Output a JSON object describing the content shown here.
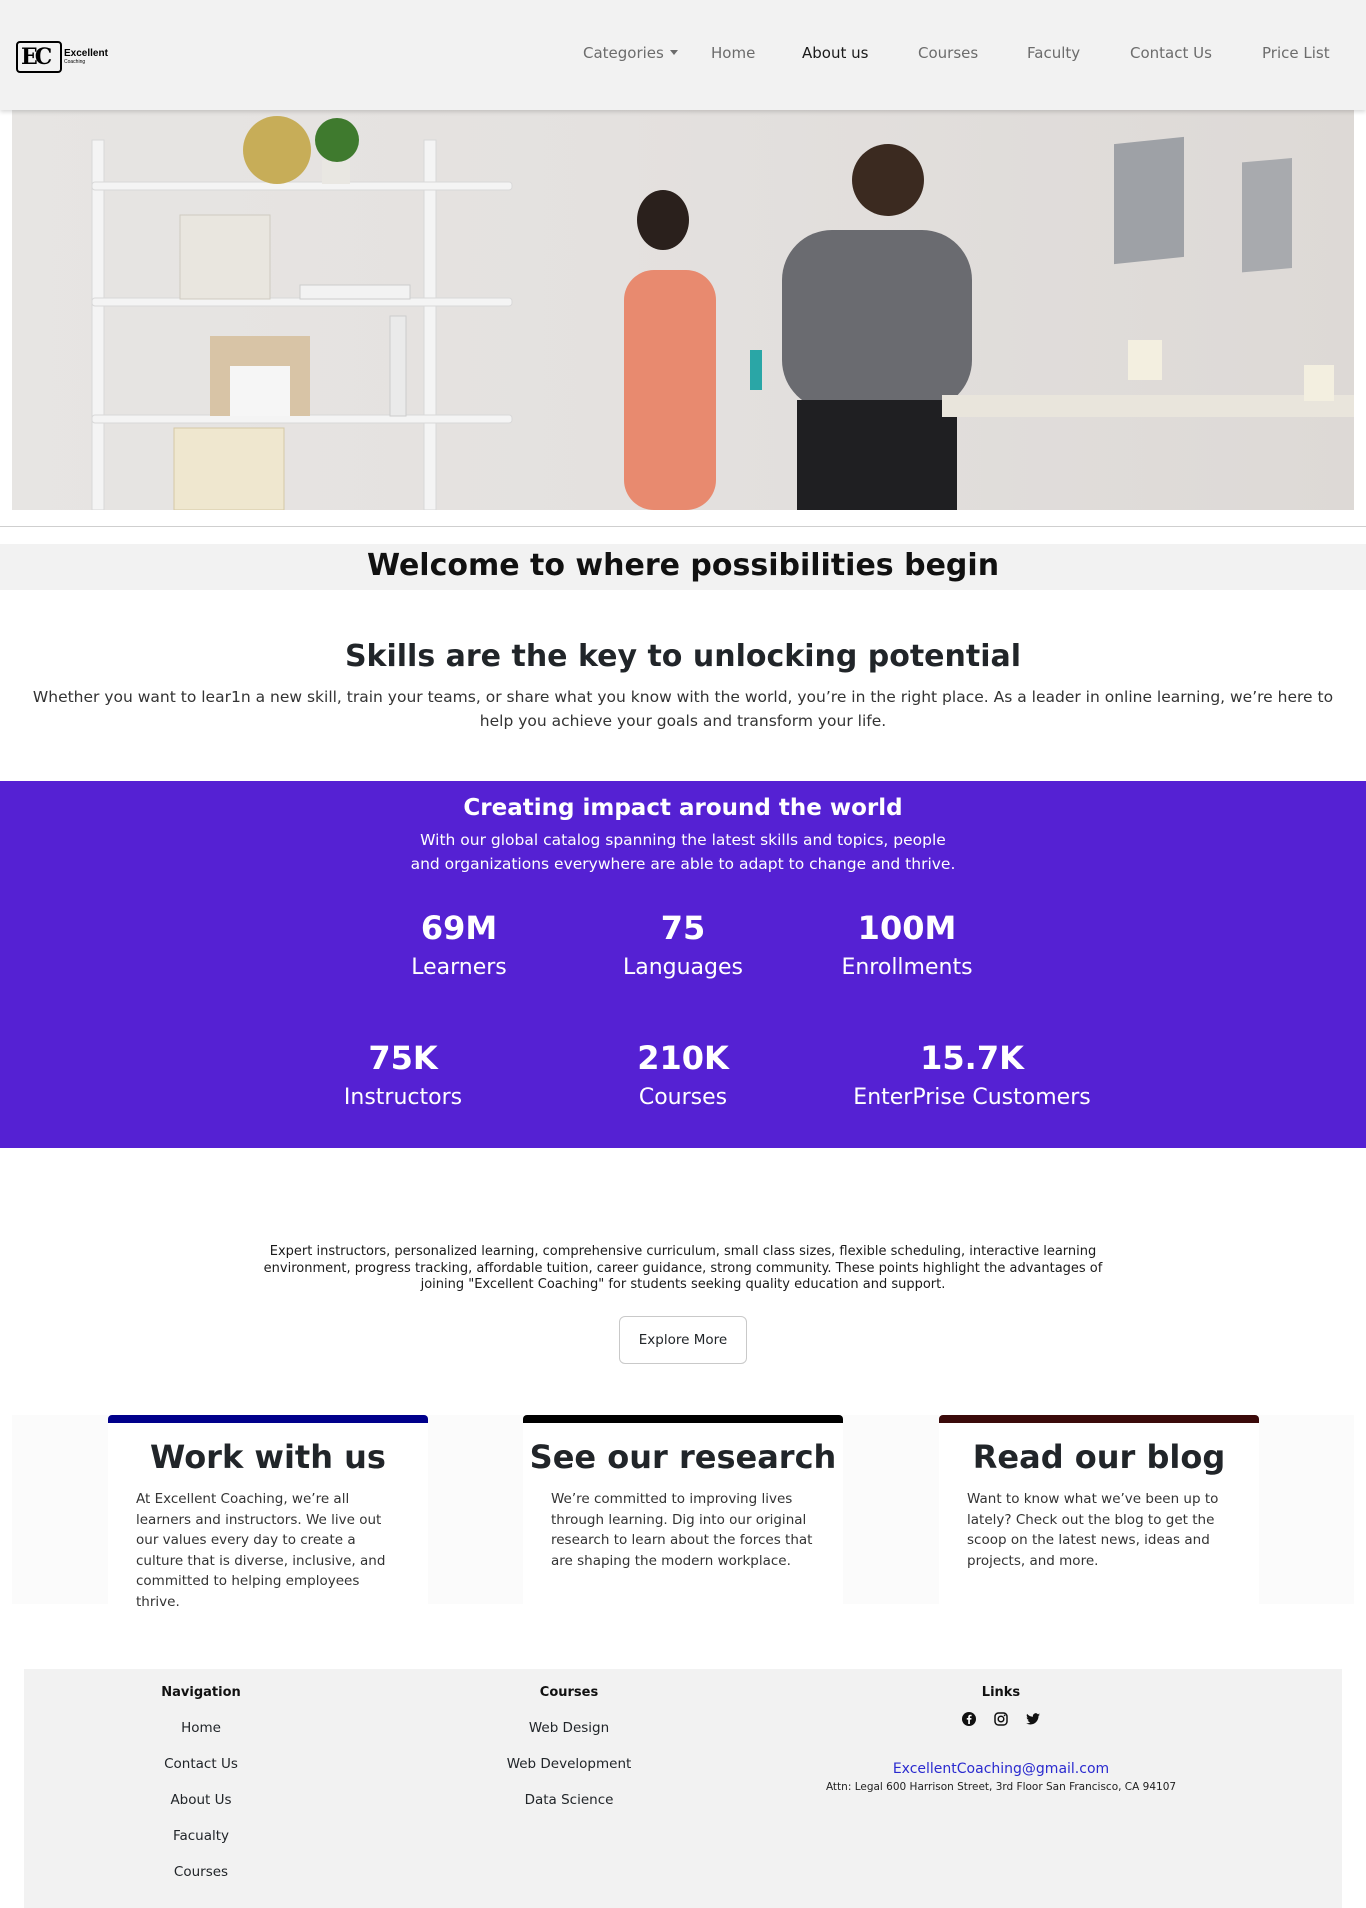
{
  "brand": {
    "logo_mark": "EC",
    "name": "Excellent",
    "tagline": "Coaching"
  },
  "nav": {
    "categories": "Categories",
    "home": "Home",
    "about": "About us",
    "courses": "Courses",
    "faculty": "Faculty",
    "contact": "Contact Us",
    "price": "Price List"
  },
  "welcome": "Welcome to where possibilities begin",
  "skills": {
    "title": "Skills are the key to unlocking potential",
    "text": "Whether you want to lear1n a new skill, train your teams, or share what you know with the world, you’re in the right place. As a leader in online learning, we’re here to help you achieve your goals and transform your life."
  },
  "impact": {
    "title": "Creating impact around the world",
    "text": "With our global catalog spanning the latest skills and topics, people and organizations everywhere are able to adapt to change and thrive.",
    "stats": [
      {
        "value": "69M",
        "label": "Learners"
      },
      {
        "value": "75",
        "label": "Languages"
      },
      {
        "value": "100M",
        "label": "Enrollments"
      },
      {
        "value": "75K",
        "label": "Instructors"
      },
      {
        "value": "210K",
        "label": "Courses"
      },
      {
        "value": "15.7K",
        "label": "EnterPrise Customers"
      }
    ]
  },
  "advantages": {
    "text": "Expert instructors, personalized learning, comprehensive curriculum, small class sizes, flexible scheduling, interactive learning environment, progress tracking, affordable tuition, career guidance, strong community. These points highlight the advantages of joining \"Excellent Coaching\" for students seeking quality education and support.",
    "button": "Explore More"
  },
  "cards": [
    {
      "title": "Work with us",
      "text": "At Excellent Coaching, we’re all learners and instructors. We live out our values every day to create a culture that is diverse, inclusive, and committed to helping employees thrive.",
      "accent": "#00008b"
    },
    {
      "title": "See our research",
      "text": "We’re committed to improving lives through learning. Dig into our original research to learn about the forces that are shaping the modern workplace.",
      "accent": "#000000"
    },
    {
      "title": "Read our blog",
      "text": "Want to know what we’ve been up to lately? Check out the blog to get the scoop on the latest news, ideas and projects, and more.",
      "accent": "#3b0a0a"
    }
  ],
  "footer": {
    "navigation": {
      "heading": "Navigation",
      "items": [
        "Home",
        "Contact Us",
        "About Us",
        "Facualty",
        "Courses"
      ]
    },
    "courses": {
      "heading": "Courses",
      "items": [
        "Web Design",
        "Web Development",
        "Data Science"
      ]
    },
    "links": {
      "heading": "Links",
      "icons": [
        "facebook-icon",
        "instagram-icon",
        "twitter-icon"
      ],
      "email": "ExcellentCoaching@gmail.com",
      "address": "Attn: Legal 600 Harrison Street, 3rd Floor San Francisco, CA 94107"
    }
  },
  "colors": {
    "impact_bg": "#5521d3",
    "nav_bg": "#f2f2f2",
    "footer_bg": "#f2f2f2",
    "email_link": "#2a2acf"
  }
}
